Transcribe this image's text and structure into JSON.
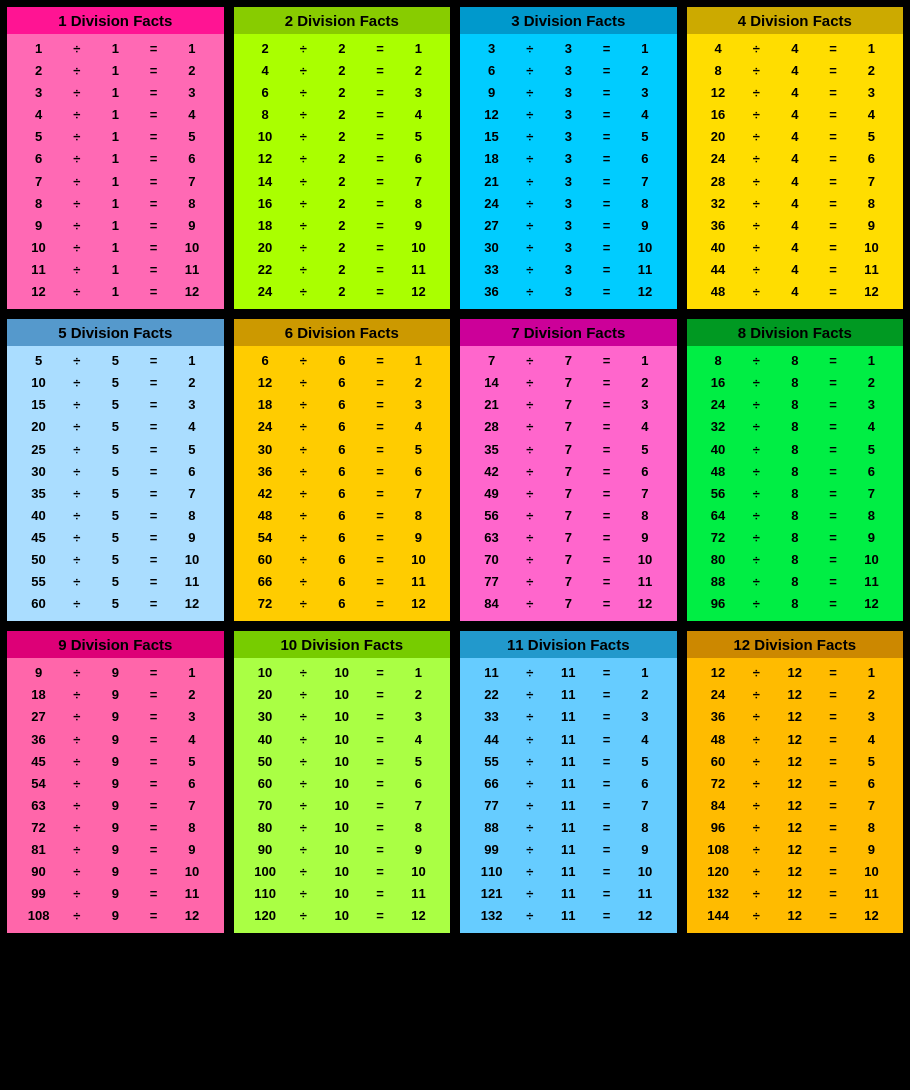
{
  "cards": [
    {
      "id": 1,
      "divisor": 1,
      "title": "1 Division Facts",
      "colorClass": "c1",
      "headerClass": "c1h",
      "facts": [
        [
          1,
          1,
          1
        ],
        [
          2,
          1,
          2
        ],
        [
          3,
          1,
          3
        ],
        [
          4,
          1,
          4
        ],
        [
          5,
          1,
          5
        ],
        [
          6,
          1,
          6
        ],
        [
          7,
          1,
          7
        ],
        [
          8,
          1,
          8
        ],
        [
          9,
          1,
          9
        ],
        [
          10,
          1,
          10
        ],
        [
          11,
          1,
          11
        ],
        [
          12,
          1,
          12
        ]
      ]
    },
    {
      "id": 2,
      "divisor": 2,
      "title": "2 Division Facts",
      "colorClass": "c2",
      "headerClass": "c2h",
      "facts": [
        [
          2,
          2,
          1
        ],
        [
          4,
          2,
          2
        ],
        [
          6,
          2,
          3
        ],
        [
          8,
          2,
          4
        ],
        [
          10,
          2,
          5
        ],
        [
          12,
          2,
          6
        ],
        [
          14,
          2,
          7
        ],
        [
          16,
          2,
          8
        ],
        [
          18,
          2,
          9
        ],
        [
          20,
          2,
          10
        ],
        [
          22,
          2,
          11
        ],
        [
          24,
          2,
          12
        ]
      ]
    },
    {
      "id": 3,
      "divisor": 3,
      "title": "3 Division Facts",
      "colorClass": "c3",
      "headerClass": "c3h",
      "facts": [
        [
          3,
          3,
          1
        ],
        [
          6,
          3,
          2
        ],
        [
          9,
          3,
          3
        ],
        [
          12,
          3,
          4
        ],
        [
          15,
          3,
          5
        ],
        [
          18,
          3,
          6
        ],
        [
          21,
          3,
          7
        ],
        [
          24,
          3,
          8
        ],
        [
          27,
          3,
          9
        ],
        [
          30,
          3,
          10
        ],
        [
          33,
          3,
          11
        ],
        [
          36,
          3,
          12
        ]
      ]
    },
    {
      "id": 4,
      "divisor": 4,
      "title": "4 Division Facts",
      "colorClass": "c4",
      "headerClass": "c4h",
      "facts": [
        [
          4,
          4,
          1
        ],
        [
          8,
          4,
          2
        ],
        [
          12,
          4,
          3
        ],
        [
          16,
          4,
          4
        ],
        [
          20,
          4,
          5
        ],
        [
          24,
          4,
          6
        ],
        [
          28,
          4,
          7
        ],
        [
          32,
          4,
          8
        ],
        [
          36,
          4,
          9
        ],
        [
          40,
          4,
          10
        ],
        [
          44,
          4,
          11
        ],
        [
          48,
          4,
          12
        ]
      ]
    },
    {
      "id": 5,
      "divisor": 5,
      "title": "5 Division Facts",
      "colorClass": "c5",
      "headerClass": "c5h",
      "facts": [
        [
          5,
          5,
          1
        ],
        [
          10,
          5,
          2
        ],
        [
          15,
          5,
          3
        ],
        [
          20,
          5,
          4
        ],
        [
          25,
          5,
          5
        ],
        [
          30,
          5,
          6
        ],
        [
          35,
          5,
          7
        ],
        [
          40,
          5,
          8
        ],
        [
          45,
          5,
          9
        ],
        [
          50,
          5,
          10
        ],
        [
          55,
          5,
          11
        ],
        [
          60,
          5,
          12
        ]
      ]
    },
    {
      "id": 6,
      "divisor": 6,
      "title": "6 Division Facts",
      "colorClass": "c6",
      "headerClass": "c6h",
      "facts": [
        [
          6,
          6,
          1
        ],
        [
          12,
          6,
          2
        ],
        [
          18,
          6,
          3
        ],
        [
          24,
          6,
          4
        ],
        [
          30,
          6,
          5
        ],
        [
          36,
          6,
          6
        ],
        [
          42,
          6,
          7
        ],
        [
          48,
          6,
          8
        ],
        [
          54,
          6,
          9
        ],
        [
          60,
          6,
          10
        ],
        [
          66,
          6,
          11
        ],
        [
          72,
          6,
          12
        ]
      ]
    },
    {
      "id": 7,
      "divisor": 7,
      "title": "7 Division Facts",
      "colorClass": "c7",
      "headerClass": "c7h",
      "facts": [
        [
          7,
          7,
          1
        ],
        [
          14,
          7,
          2
        ],
        [
          21,
          7,
          3
        ],
        [
          28,
          7,
          4
        ],
        [
          35,
          7,
          5
        ],
        [
          42,
          7,
          6
        ],
        [
          49,
          7,
          7
        ],
        [
          56,
          7,
          8
        ],
        [
          63,
          7,
          9
        ],
        [
          70,
          7,
          10
        ],
        [
          77,
          7,
          11
        ],
        [
          84,
          7,
          12
        ]
      ]
    },
    {
      "id": 8,
      "divisor": 8,
      "title": "8 Division Facts",
      "colorClass": "c8",
      "headerClass": "c8h",
      "facts": [
        [
          8,
          8,
          1
        ],
        [
          16,
          8,
          2
        ],
        [
          24,
          8,
          3
        ],
        [
          32,
          8,
          4
        ],
        [
          40,
          8,
          5
        ],
        [
          48,
          8,
          6
        ],
        [
          56,
          8,
          7
        ],
        [
          64,
          8,
          8
        ],
        [
          72,
          8,
          9
        ],
        [
          80,
          8,
          10
        ],
        [
          88,
          8,
          11
        ],
        [
          96,
          8,
          12
        ]
      ]
    },
    {
      "id": 9,
      "divisor": 9,
      "title": "9 Division Facts",
      "colorClass": "c9",
      "headerClass": "c9h",
      "facts": [
        [
          9,
          9,
          1
        ],
        [
          18,
          9,
          2
        ],
        [
          27,
          9,
          3
        ],
        [
          36,
          9,
          4
        ],
        [
          45,
          9,
          5
        ],
        [
          54,
          9,
          6
        ],
        [
          63,
          9,
          7
        ],
        [
          72,
          9,
          8
        ],
        [
          81,
          9,
          9
        ],
        [
          90,
          9,
          10
        ],
        [
          99,
          9,
          11
        ],
        [
          108,
          9,
          12
        ]
      ]
    },
    {
      "id": 10,
      "divisor": 10,
      "title": "10 Division Facts",
      "colorClass": "c10",
      "headerClass": "c10h",
      "facts": [
        [
          10,
          10,
          1
        ],
        [
          20,
          10,
          2
        ],
        [
          30,
          10,
          3
        ],
        [
          40,
          10,
          4
        ],
        [
          50,
          10,
          5
        ],
        [
          60,
          10,
          6
        ],
        [
          70,
          10,
          7
        ],
        [
          80,
          10,
          8
        ],
        [
          90,
          10,
          9
        ],
        [
          100,
          10,
          10
        ],
        [
          110,
          10,
          11
        ],
        [
          120,
          10,
          12
        ]
      ]
    },
    {
      "id": 11,
      "divisor": 11,
      "title": "11 Division Facts",
      "colorClass": "c11",
      "headerClass": "c11h",
      "facts": [
        [
          11,
          11,
          1
        ],
        [
          22,
          11,
          2
        ],
        [
          33,
          11,
          3
        ],
        [
          44,
          11,
          4
        ],
        [
          55,
          11,
          5
        ],
        [
          66,
          11,
          6
        ],
        [
          77,
          11,
          7
        ],
        [
          88,
          11,
          8
        ],
        [
          99,
          11,
          9
        ],
        [
          110,
          11,
          10
        ],
        [
          121,
          11,
          11
        ],
        [
          132,
          11,
          12
        ]
      ]
    },
    {
      "id": 12,
      "divisor": 12,
      "title": "12 Division Facts",
      "colorClass": "c12",
      "headerClass": "c12h",
      "facts": [
        [
          12,
          12,
          1
        ],
        [
          24,
          12,
          2
        ],
        [
          36,
          12,
          3
        ],
        [
          48,
          12,
          4
        ],
        [
          60,
          12,
          5
        ],
        [
          72,
          12,
          6
        ],
        [
          84,
          12,
          7
        ],
        [
          96,
          12,
          8
        ],
        [
          108,
          12,
          9
        ],
        [
          120,
          12,
          10
        ],
        [
          132,
          12,
          11
        ],
        [
          144,
          12,
          12
        ]
      ]
    }
  ]
}
